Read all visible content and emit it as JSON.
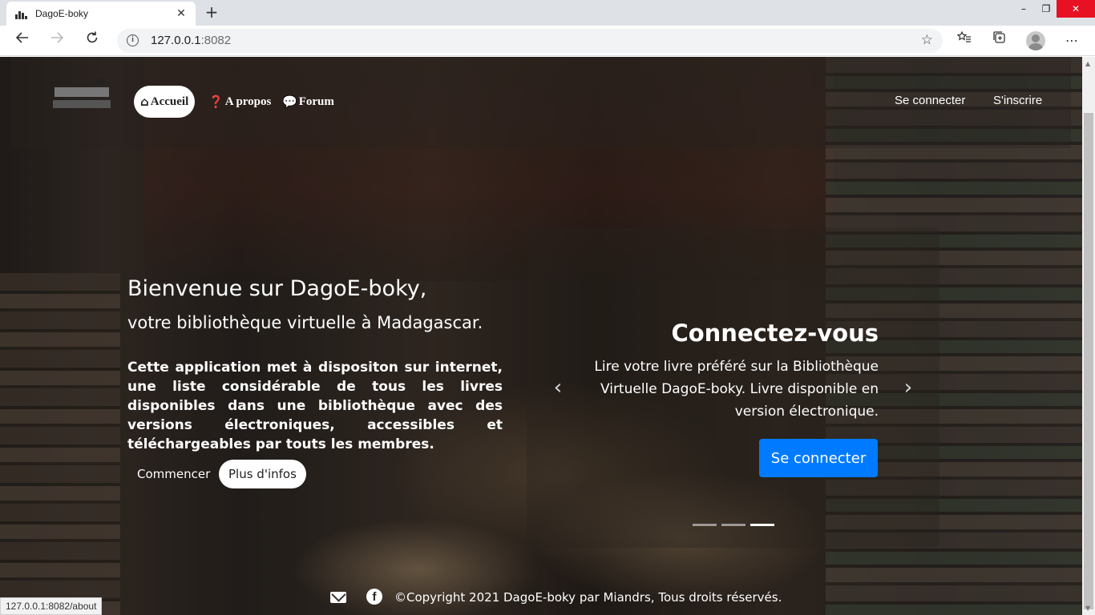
{
  "browser": {
    "tab_title": "DagoE-boky",
    "tab_close": "✕",
    "new_tab": "+",
    "url_host": "127.0.0.1",
    "url_port": ":8082",
    "status_url": "127.0.0.1:8082/about",
    "window_controls": {
      "minimize": "–",
      "maximize": "❐",
      "close": "✕"
    },
    "icons": {
      "back": "arrow-left-icon",
      "forward": "arrow-right-icon",
      "reload": "reload-icon",
      "star": "star-icon",
      "favorites": "favorites-icon",
      "collections": "collections-icon",
      "menu": "more-icon"
    }
  },
  "nav": {
    "items": [
      {
        "icon": "⌂",
        "label": "Accueil",
        "active": true
      },
      {
        "icon": "❓",
        "label": "A propos",
        "active": false
      },
      {
        "icon": "💬",
        "label": "Forum",
        "active": false
      }
    ],
    "login": "Se connecter",
    "signup": "S'inscrire"
  },
  "hero": {
    "title": "Bienvenue sur DagoE-boky,",
    "subtitle": "votre bibliothèque virtuelle à Madagascar.",
    "description": "Cette application met à dispositon sur internet, une liste considérable de tous les livres disponibles dans une bibliothèque avec des versions électroniques, accessibles et téléchargeables par touts les membres.",
    "btn_start": "Commencer",
    "btn_more": "Plus d'infos"
  },
  "carousel": {
    "title": "Connectez-vous",
    "text": "Lire votre livre préféré sur la Bibliothèque Virtuelle DagoE-boky. Livre disponible en version électronique.",
    "button": "Se connecter",
    "prev": "‹",
    "next": "›",
    "slides_total": 3,
    "active_slide": 3
  },
  "footer": {
    "copyright": "©Copyright 2021 DagoE-boky par Miandrs, Tous droits réservés.",
    "fb": "f"
  },
  "colors": {
    "primary": "#007bff",
    "close_btn": "#e81123"
  }
}
